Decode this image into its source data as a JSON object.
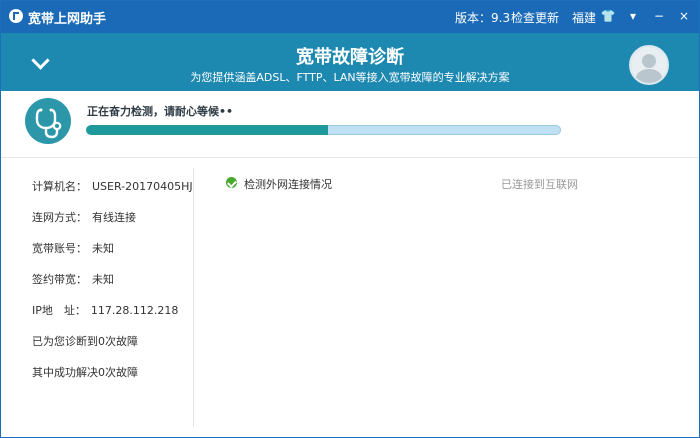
{
  "titlebar": {
    "app_title": "宽带上网助手",
    "version": "版本：9.3",
    "update": "检查更新",
    "region": "福建",
    "controls": {
      "skin": "👕",
      "menu": "▾",
      "minimize": "−",
      "close": "×"
    }
  },
  "header": {
    "title": "宽带故障诊断",
    "subtitle": "为您提供涵盖ADSL、FTTP、LAN等接入宽带故障的专业解决方案"
  },
  "progress": {
    "status": "正在奋力检测，请耐心等候••",
    "value": 0.51,
    "fill_color": "#1f9a9c"
  },
  "info": {
    "rows": [
      {
        "label": "计算机名：",
        "value": "USER-20170405HJ"
      },
      {
        "label": "连网方式：",
        "value": "有线连接"
      },
      {
        "label": "宽带账号：",
        "value": "未知"
      },
      {
        "label": "签约带宽：",
        "value": "未知"
      },
      {
        "label": "IP地　址：",
        "value": "117.28.112.218"
      },
      {
        "label": "已为您诊断到0次故障",
        "value": ""
      },
      {
        "label": "其中成功解决0次故障",
        "value": ""
      }
    ]
  },
  "checks": [
    {
      "label": "检测外网连接情况",
      "result": "已连接到互联网"
    }
  ],
  "colors": {
    "titlebar": "#1a6ab8",
    "header": "#1d88b0",
    "success": "#49a92d"
  }
}
